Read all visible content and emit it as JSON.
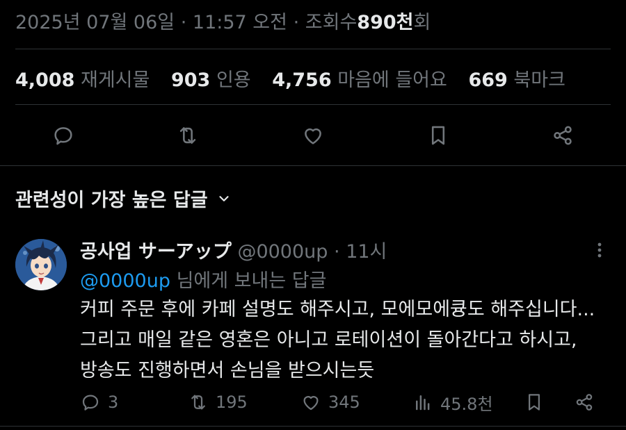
{
  "meta": {
    "date": "2025년 07월 06일",
    "separator": "·",
    "time": "11:57 오전",
    "views_label": "조회수",
    "views_number": "890천",
    "views_unit": "회"
  },
  "stats": [
    {
      "value": "4,008",
      "label": "재게시물"
    },
    {
      "value": "903",
      "label": "인용"
    },
    {
      "value": "4,756",
      "label": "마음에 들어요"
    },
    {
      "value": "669",
      "label": "북마크"
    }
  ],
  "actions": {
    "reply": "reply-icon",
    "repost": "repost-icon",
    "like": "heart-icon",
    "bookmark": "bookmark-icon",
    "share": "share-icon"
  },
  "sort": {
    "label": "관련성이 가장 높은 답글"
  },
  "reply": {
    "name": "공사업 サーアップ",
    "handle": "@0000up",
    "separator": "·",
    "time": "11시",
    "reply_to_mention": "@0000up",
    "reply_to_suffix": "님에게 보내는 답글",
    "lines": [
      "커피 주문 후에 카페 설명도 해주시고, 모에모에큥도 해주십니다...",
      "그리고 매일 같은 영혼은 아니고 로테이션이 돌아간다고 하시고,",
      "방송도 진행하면서 손님을 받으시는듯"
    ],
    "counts": {
      "replies": "3",
      "reposts": "195",
      "likes": "345",
      "views": "45.8천"
    }
  },
  "colors": {
    "background": "#000000",
    "text": "#e7e9ea",
    "muted": "#71767b",
    "link": "#1d9bf0",
    "divider": "#2f3336"
  }
}
